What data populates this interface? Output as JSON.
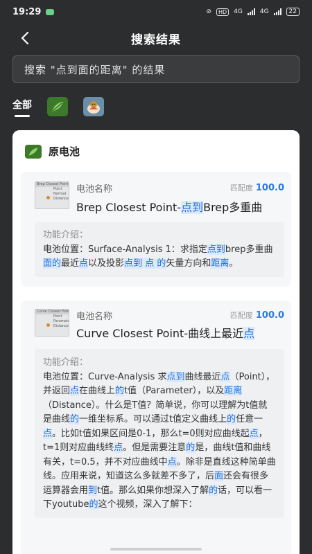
{
  "status_bar": {
    "time": "19:29",
    "hd": "HD",
    "net1": "4G",
    "net2": "4G",
    "battery": "22"
  },
  "header": {
    "title": "搜索结果"
  },
  "search": {
    "query_text": "搜索 \"点到面的距离\" 的结果"
  },
  "tabs": [
    {
      "label": "全部",
      "active": true
    },
    {
      "icon": "grasshopper-leaf-icon"
    },
    {
      "icon": "ladybug-chick-icon"
    }
  ],
  "group": {
    "name": "原电池"
  },
  "results": [
    {
      "label": "电池名称",
      "match_label": "匹配度",
      "match_value": "100.0",
      "thumb": {
        "title": "Brep Closest Point",
        "rows": [
          "Point",
          "Normal",
          "Distance"
        ]
      },
      "name_parts": [
        "Brep Closest Point-",
        "点到",
        "Brep多重曲"
      ],
      "desc_title": "功能介绍：",
      "desc_parts": [
        "电池位置：Surface-Analysis 1：求指定",
        "点到",
        "brep多重曲",
        "面的",
        "最近",
        "点",
        "以及投影",
        "点到 点 的",
        "矢量方向和",
        "距离",
        "。"
      ]
    },
    {
      "label": "电池名称",
      "match_label": "匹配度",
      "match_value": "100.0",
      "thumb": {
        "title": "Curve Closest Point",
        "rows": [
          "Point",
          "Parameter",
          "Distance"
        ]
      },
      "name_parts": [
        "Curve Closest Point-曲线上最近",
        "点"
      ],
      "desc_title": "功能介绍：",
      "desc_parts": [
        "电池位置：Curve-Analysis 求",
        "点到",
        "曲线最近",
        "点",
        "（Point），并返回",
        "点",
        "在曲线上",
        "的",
        "t值（Parameter），以及",
        "距离",
        "（Distance）。什么是T值？简单说，你可以理解为t值就是曲线",
        "的",
        "一维坐标系。可以通过t值定义曲线上",
        "的",
        "任意一",
        "点",
        "。比如t值如果区间是0-1，那么t=0则对应曲线起",
        "点",
        "，t=1则对应曲线终",
        "点",
        "。但是需要注意",
        "的",
        "是，曲线t值和曲线有关，t=0.5，并不对应曲线中",
        "点",
        "。除非是直线这种简单曲线。应用来说，知道这么多就差不多了，后",
        "面",
        "还会有很多运算器会用",
        "到",
        "t值。那么如果你想深入了解",
        "的",
        "话，可以看一下youtube",
        "的",
        "这个视频，深入了解下："
      ]
    }
  ],
  "colors": {
    "background": "#2b2d2e",
    "highlight_bg": "#dce9fb",
    "highlight_text": "#1f6fd8",
    "match_value": "#2b7adf"
  }
}
